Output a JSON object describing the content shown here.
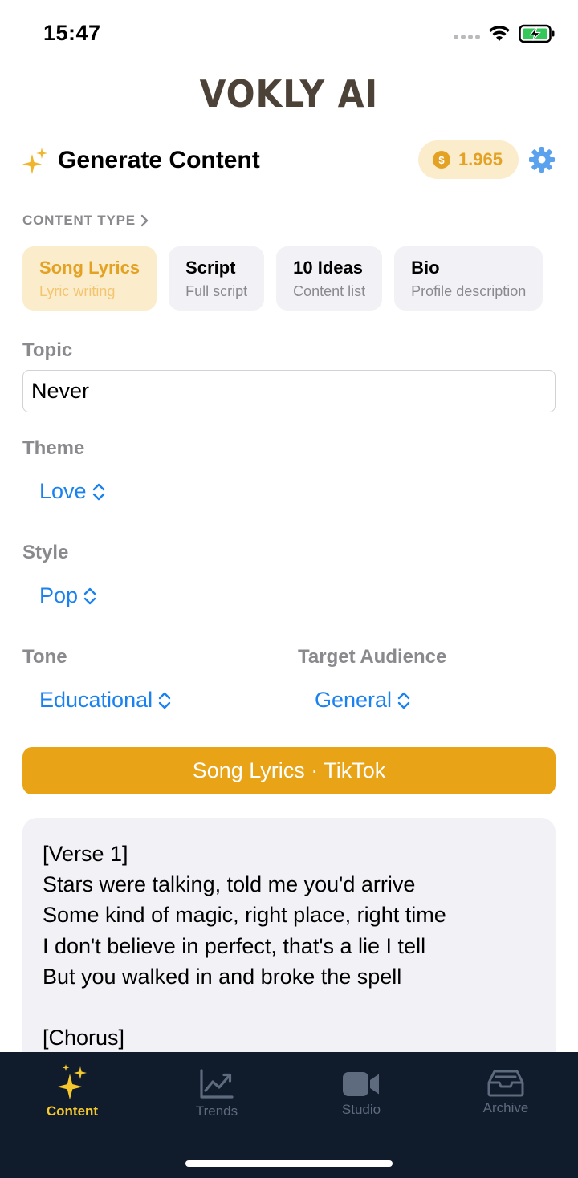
{
  "status_bar": {
    "time": "15:47"
  },
  "brand": {
    "name": "VOKLY AI"
  },
  "header": {
    "title": "Generate Content",
    "coin_symbol": "$",
    "coin_balance": "1.965"
  },
  "content_type": {
    "label": "CONTENT TYPE",
    "options": [
      {
        "title": "Song Lyrics",
        "subtitle": "Lyric writing",
        "selected": true
      },
      {
        "title": "Script",
        "subtitle": "Full script",
        "selected": false
      },
      {
        "title": "10 Ideas",
        "subtitle": "Content list",
        "selected": false
      },
      {
        "title": "Bio",
        "subtitle": "Profile description",
        "selected": false
      }
    ]
  },
  "topic": {
    "label": "Topic",
    "value": "Never"
  },
  "theme": {
    "label": "Theme",
    "value": "Love"
  },
  "style": {
    "label": "Style",
    "value": "Pop"
  },
  "tone": {
    "label": "Tone",
    "value": "Educational"
  },
  "audience": {
    "label": "Target Audience",
    "value": "General"
  },
  "generate_button": {
    "label": "Song Lyrics · TikTok"
  },
  "output": {
    "text": "[Verse 1]\nStars were talking, told me you'd arrive\nSome kind of magic, right place, right time\nI don't believe in perfect, that's a lie I tell\nBut you walked in and broke the spell\n\n[Chorus]"
  },
  "tabbar": {
    "tabs": [
      {
        "label": "Content",
        "icon": "sparkles-icon",
        "active": true
      },
      {
        "label": "Trends",
        "icon": "chart-line-icon",
        "active": false
      },
      {
        "label": "Studio",
        "icon": "video-camera-icon",
        "active": false
      },
      {
        "label": "Archive",
        "icon": "archive-box-icon",
        "active": false
      }
    ]
  },
  "colors": {
    "accent": "#e8a317",
    "accent_light": "#fbeccc",
    "link_blue": "#1a82f0",
    "tabbar_bg": "#101b2b",
    "tab_active": "#f5c82e",
    "tab_inactive": "#5e6b7e",
    "battery_green": "#34c759"
  }
}
